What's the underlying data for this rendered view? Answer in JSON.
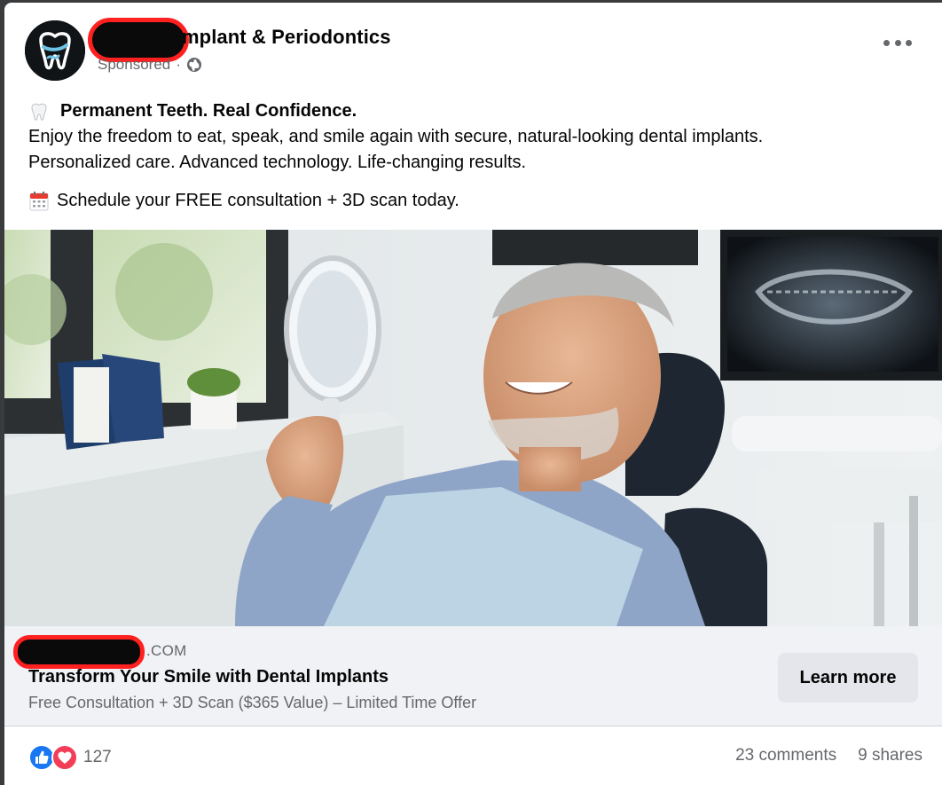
{
  "post": {
    "page_name_visible": "mplant & Periodontics",
    "sponsored_label": "Sponsored",
    "meta_separator": "·",
    "headline": "Permanent Teeth. Real Confidence.",
    "body_line1": "Enjoy the freedom to eat, speak, and smile again with secure, natural-looking dental implants.",
    "body_line2": "Personalized care. Advanced technology. Life-changing results.",
    "cta_text": "Schedule your FREE consultation + 3D scan today."
  },
  "icons": {
    "avatar": "tooth-logo-icon",
    "privacy": "globe-icon",
    "more": "more-options-icon",
    "headline_emoji": "tooth-icon",
    "cta_emoji": "calendar-icon",
    "reaction_like": "like-icon",
    "reaction_love": "love-icon"
  },
  "link_card": {
    "domain_suffix": ".COM",
    "title": "Transform Your Smile with Dental Implants",
    "description": "Free Consultation + 3D Scan ($365 Value) – Limited Time Offer",
    "button_label": "Learn more"
  },
  "engagement": {
    "reaction_count": "127",
    "comments": "23 comments",
    "shares": "9 shares"
  },
  "colors": {
    "like_blue": "#1877f2",
    "love_red": "#f33e58",
    "secondary_text": "#65676b",
    "redaction_outline": "#ff2020"
  }
}
